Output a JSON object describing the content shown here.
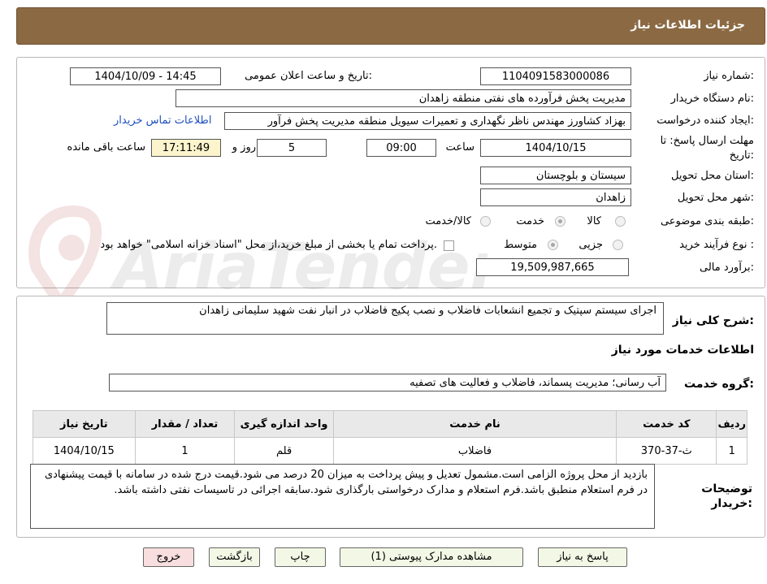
{
  "header": {
    "title": "جزئیات اطلاعات نیاز"
  },
  "form": {
    "need_number_label": "شماره نیاز:",
    "need_number": "1104091583000086",
    "announce_label": "تاریخ و ساعت اعلان عمومی:",
    "announce_value": "1404/10/09 - 14:45",
    "buyer_org_label": "نام دستگاه خریدار:",
    "buyer_org": "مدیریت پخش فرآورده های نفتی منطقه زاهدان",
    "creator_label": "ایجاد کننده درخواست:",
    "creator": "بهزاد کشاورز مهندس ناظر نگهداری و تعمیرات سیویل منطقه  مدیریت پخش فرآور",
    "contact_link": "اطلاعات تماس خریدار",
    "deadline_label_1": "مهلت ارسال پاسخ: تا",
    "deadline_label_2": "تاریخ:",
    "deadline_date": "1404/10/15",
    "time_label": "ساعت",
    "deadline_time": "09:00",
    "days_value": "5",
    "days_label": "روز و",
    "remaining_time": "17:11:49",
    "remaining_label": "ساعت باقی مانده",
    "province_label": "استان محل تحویل:",
    "province": "سیستان و بلوچستان",
    "city_label": "شهر محل تحویل:",
    "city": "زاهدان",
    "category_label": "طبقه بندی موضوعی:",
    "category_options": [
      "کالا",
      "خدمت",
      "کالا/خدمت"
    ],
    "category_selected": "خدمت",
    "process_label": "نوع فرآیند خرید :",
    "process_options": [
      "جزیی",
      "متوسط"
    ],
    "process_selected": "متوسط",
    "payment_note": "پرداخت تمام یا بخشی از مبلغ خرید،از محل \"اسناد خزانه اسلامی\" خواهد بود.",
    "budget_label": "برآورد مالی:",
    "budget": "19,509,987,665"
  },
  "description": {
    "label": "شرح کلی نیاز:",
    "text": "اجرای سیستم سپتیک و تجمیع انشعابات فاضلاب و نصب پکیج فاضلاب در انبار نفت شهید سلیمانی زاهدان"
  },
  "services": {
    "section_title": "اطلاعات خدمات مورد نیاز",
    "group_label": "گروه خدمت:",
    "group_value": "آب رسانی؛ مدیریت پسماند، فاضلاب و فعالیت های تصفیه",
    "table": {
      "headers": [
        "ردیف",
        "کد خدمت",
        "نام خدمت",
        "واحد اندازه گیری",
        "تعداد / مقدار",
        "تاریخ نیاز"
      ],
      "rows": [
        [
          "1",
          "ث-37-370",
          "فاضلاب",
          "قلم",
          "1",
          "1404/10/15"
        ]
      ]
    }
  },
  "buyer_notes": {
    "label_1": "توضیحات",
    "label_2": "خریدار:",
    "text": "بازدید از محل پروژه الزامی است.مشمول تعدیل و پیش پرداخت به میزان 20 درصد می شود.قیمت درج شده در سامانه با قیمت پیشنهادی در فرم استعلام منطبق باشد.فرم استعلام و مدارک درخواستی بارگذاری شود.سابقه اجرائی در تاسیسات نفتی داشته باشد."
  },
  "buttons": {
    "respond": "پاسخ به نیاز",
    "attachments": "مشاهده مدارک پیوستی (1)",
    "print": "چاپ",
    "back": "بازگشت",
    "exit": "خروج"
  },
  "watermark": {
    "text": "AriaTender.net"
  },
  "colors": {
    "header_bg": "#8b6a43",
    "link": "#1f4fbf",
    "button_bg": "#f3f8e6",
    "exit_bg": "#f8dede"
  }
}
